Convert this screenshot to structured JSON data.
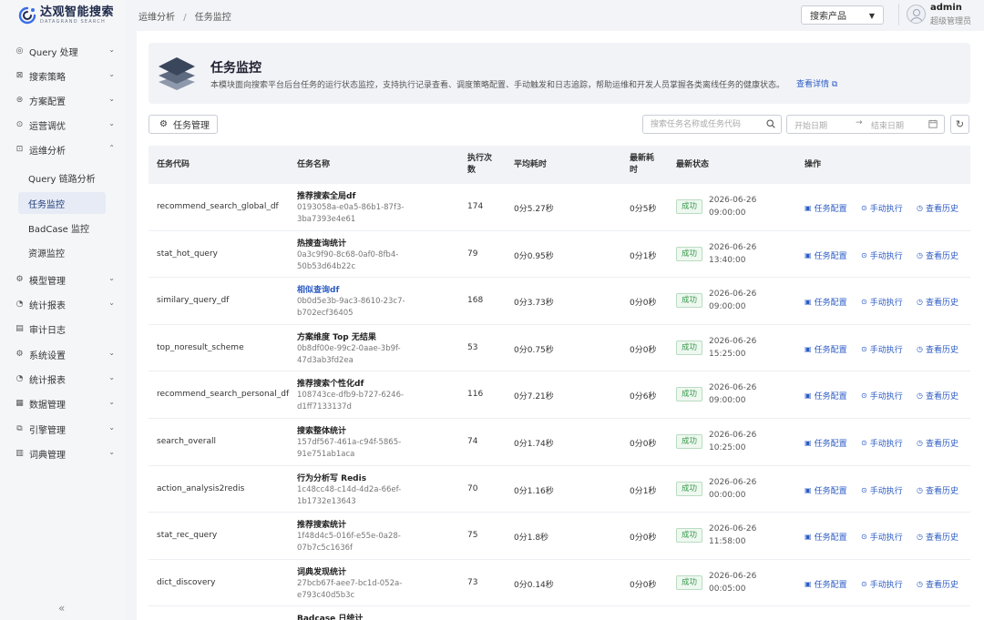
{
  "logo": {
    "text": "达观智能搜索",
    "sub": "DATAGRAND SEARCH"
  },
  "menu": [
    {
      "label": "Query 处理",
      "icon": "◎",
      "chev": "⌄"
    },
    {
      "label": "搜索策略",
      "icon": "⊠",
      "chev": "⌄"
    },
    {
      "label": "方案配置",
      "icon": "⊜",
      "chev": "⌄"
    },
    {
      "label": "运营调优",
      "icon": "⊙",
      "chev": "⌄"
    },
    {
      "label": "运维分析",
      "icon": "⊡",
      "chev": "⌃"
    },
    {
      "label": "模型管理",
      "icon": "⚙",
      "chev": "⌄"
    },
    {
      "label": "统计报表",
      "icon": "◔",
      "chev": "⌄"
    },
    {
      "label": "审计日志",
      "icon": "▤",
      "chev": ""
    },
    {
      "label": "系统设置",
      "icon": "⚙",
      "chev": "⌄"
    },
    {
      "label": "统计报表",
      "icon": "◔",
      "chev": "⌄"
    },
    {
      "label": "数据管理",
      "icon": "▦",
      "chev": "⌄"
    },
    {
      "label": "引擎管理",
      "icon": "⧉",
      "chev": "⌄"
    },
    {
      "label": "词典管理",
      "icon": "▥",
      "chev": "⌄"
    }
  ],
  "submenu": [
    {
      "label": "Query 链路分析"
    },
    {
      "label": "任务监控"
    },
    {
      "label": "BadCase 监控"
    },
    {
      "label": "资源监控"
    }
  ],
  "collapse": "«",
  "breadcrumb": {
    "parent": "运维分析",
    "sep": "/",
    "current": "任务监控"
  },
  "product_select": {
    "value": "搜索产品",
    "caret": "▼"
  },
  "user": {
    "name": "admin",
    "role": "超级管理员"
  },
  "hero": {
    "title": "任务监控",
    "desc": "本模块面向搜索平台后台任务的运行状态监控，支持执行记录查看、调度策略配置、手动触发和日志追踪，帮助运维和开发人员掌握各类离线任务的健康状态。",
    "link": "查看详情 ⧉"
  },
  "toolbar": {
    "manage_label": "任务管理",
    "search_placeholder": "搜索任务名称或任务代码",
    "date_start": "开始日期",
    "date_arrow": "→",
    "date_end": "结束日期",
    "refresh": "↻"
  },
  "table": {
    "headers": {
      "code": "任务代码",
      "name": "任务名称",
      "count": "执行次数",
      "avg": "平均耗时",
      "last": "最新耗时",
      "status": "最新状态",
      "ops": "操作"
    },
    "actions": {
      "config": "任务配置",
      "run": "手动执行",
      "history": "查看历史"
    },
    "rows": [
      {
        "code": "recommend_search_global_df",
        "name": "推荐搜索全局df",
        "uuid": "0193058a-e0a5-86b1-87f3-3ba7393e4e61",
        "count": "174",
        "avg": "0分5.27秒",
        "last": "0分5秒",
        "status": "成功",
        "time": "2026-06-26 09:00:00"
      },
      {
        "code": "stat_hot_query",
        "name": "热搜查询统计",
        "uuid": "0a3c9f90-8c68-0af0-8fb4-50b53d64b22c",
        "count": "79",
        "avg": "0分0.95秒",
        "last": "0分1秒",
        "status": "成功",
        "time": "2026-06-26 13:40:00"
      },
      {
        "code": "similary_query_df",
        "name": "相似查询df",
        "uuid": "0b0d5e3b-9ac3-8610-23c7-b702ecf36405",
        "count": "168",
        "avg": "0分3.73秒",
        "last": "0分0秒",
        "status": "成功",
        "time": "2026-06-26 09:00:00"
      },
      {
        "code": "top_noresult_scheme",
        "name": "方案维度 Top 无结果",
        "uuid": "0b8df00e-99c2-0aae-3b9f-47d3ab3fd2ea",
        "count": "53",
        "avg": "0分0.75秒",
        "last": "0分0秒",
        "status": "成功",
        "time": "2026-06-26 15:25:00"
      },
      {
        "code": "recommend_search_personal_df",
        "name": "推荐搜索个性化df",
        "uuid": "108743ce-dfb9-b727-6246-d1ff7133137d",
        "count": "116",
        "avg": "0分7.21秒",
        "last": "0分6秒",
        "status": "成功",
        "time": "2026-06-26 09:00:00"
      },
      {
        "code": "search_overall",
        "name": "搜索整体统计",
        "uuid": "157df567-461a-c94f-5865-91e751ab1aca",
        "count": "74",
        "avg": "0分1.74秒",
        "last": "0分0秒",
        "status": "成功",
        "time": "2026-06-26 10:25:00"
      },
      {
        "code": "action_analysis2redis",
        "name": "行为分析写 Redis",
        "uuid": "1c48cc48-c14d-4d2a-66ef-1b1732e13643",
        "count": "70",
        "avg": "0分1.16秒",
        "last": "0分1秒",
        "status": "成功",
        "time": "2026-06-26 00:00:00"
      },
      {
        "code": "stat_rec_query",
        "name": "推荐搜索统计",
        "uuid": "1f48d4c5-016f-e55e-0a28-07b7c5c1636f",
        "count": "75",
        "avg": "0分1.8秒",
        "last": "0分0秒",
        "status": "成功",
        "time": "2026-06-26 11:58:00"
      },
      {
        "code": "dict_discovery",
        "name": "词典发现统计",
        "uuid": "27bcb67f-aee7-bc1d-052a-e793c40d5b3c",
        "count": "73",
        "avg": "0分0.14秒",
        "last": "0分0秒",
        "status": "成功",
        "time": "2026-06-26 00:05:00"
      },
      {
        "code": "",
        "name": "Badcase 日统计",
        "uuid": "",
        "count": "",
        "avg": "",
        "last": "",
        "status": "",
        "time": ""
      }
    ]
  }
}
